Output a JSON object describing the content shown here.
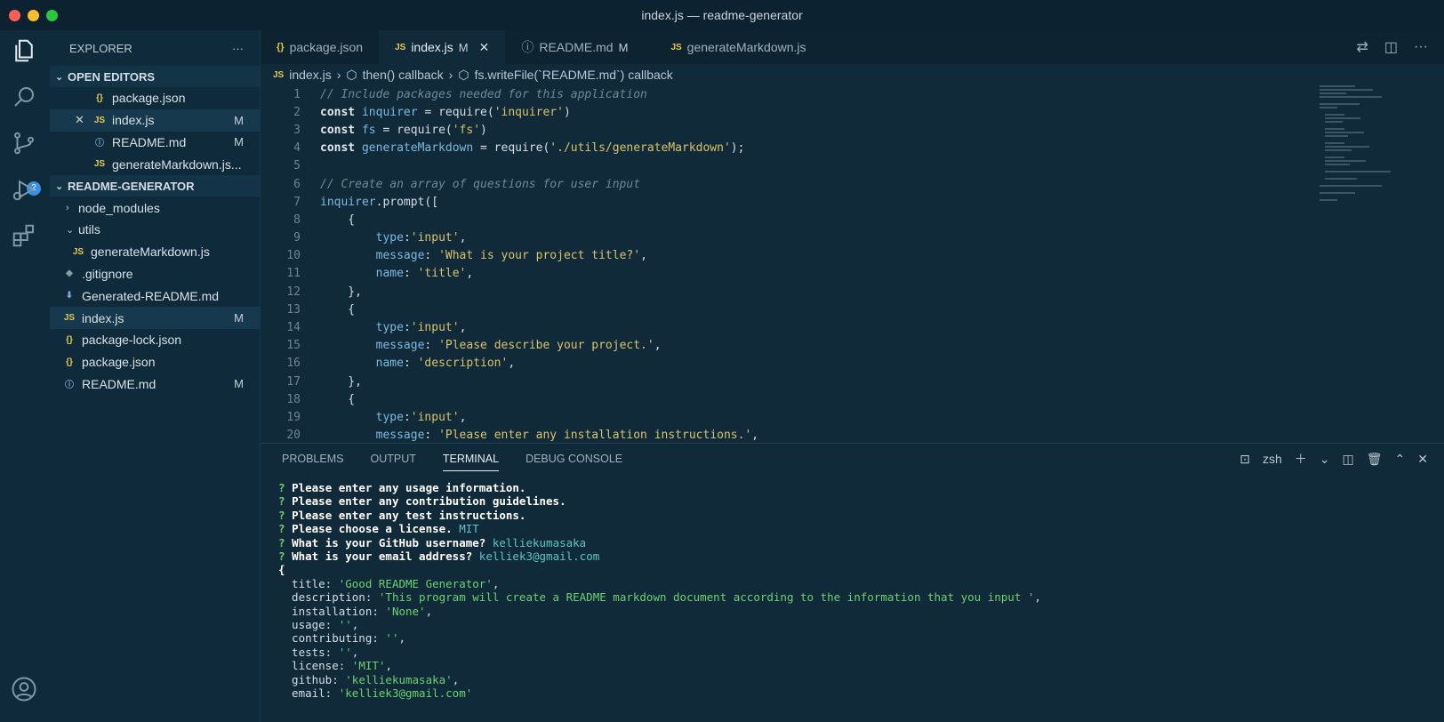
{
  "window": {
    "title": "index.js — readme-generator"
  },
  "colors": {
    "close": "#ff5f57",
    "minimize": "#febc2e",
    "maximize": "#28c840",
    "accent": "#3a8ee6"
  },
  "activity_bar": {
    "scm_badge": "2"
  },
  "sidebar": {
    "header": "EXPLORER",
    "open_editors_title": "OPEN EDITORS",
    "open_editors": [
      {
        "icon": "{}",
        "name": "package.json",
        "status": ""
      },
      {
        "icon": "JS",
        "name": "index.js",
        "status": "M"
      },
      {
        "icon": "ⓘ",
        "name": "README.md",
        "status": "M"
      },
      {
        "icon": "JS",
        "name": "generateMarkdown.js...",
        "status": ""
      }
    ],
    "project_title": "README-GENERATOR",
    "tree": [
      {
        "name": "node_modules",
        "status": ""
      },
      {
        "name": "utils",
        "status": ""
      },
      {
        "name": "generateMarkdown.js",
        "status": ""
      },
      {
        "name": ".gitignore",
        "status": ""
      },
      {
        "name": "Generated-README.md",
        "status": ""
      },
      {
        "name": "index.js",
        "status": "M"
      },
      {
        "name": "package-lock.json",
        "status": ""
      },
      {
        "name": "package.json",
        "status": ""
      },
      {
        "name": "README.md",
        "status": "M"
      }
    ]
  },
  "tabs": [
    {
      "icon": "{}",
      "label": "package.json",
      "status": ""
    },
    {
      "icon": "JS",
      "label": "index.js",
      "status": "M"
    },
    {
      "icon": "ⓘ",
      "label": "README.md",
      "status": "M"
    },
    {
      "icon": "JS",
      "label": "generateMarkdown.js",
      "status": ""
    }
  ],
  "breadcrumb": {
    "file": "index.js",
    "b1": "then() callback",
    "b2": "fs.writeFile(`README.md`) callback"
  },
  "code_lines": [
    "// Include packages needed for this application",
    "const inquirer = require('inquirer')",
    "const fs = require('fs')",
    "const generateMarkdown = require('./utils/generateMarkdown');",
    "",
    "// Create an array of questions for user input",
    "inquirer.prompt([",
    "    {",
    "        type:'input',",
    "        message: 'What is your project title?',",
    "        name: 'title',",
    "    },",
    "    {",
    "        type:'input',",
    "        message: 'Please describe your project.',",
    "        name: 'description',",
    "    },",
    "    {",
    "        type:'input',",
    "        message: 'Please enter any installation instructions.',"
  ],
  "panel": {
    "tabs": [
      "PROBLEMS",
      "OUTPUT",
      "TERMINAL",
      "DEBUG CONSOLE"
    ],
    "shell": "zsh"
  },
  "terminal": {
    "prompts": [
      {
        "q": "Please enter any usage information.",
        "a": ""
      },
      {
        "q": "Please enter any contribution guidelines.",
        "a": ""
      },
      {
        "q": "Please enter any test instructions.",
        "a": ""
      },
      {
        "q": "Please choose a license.",
        "a": "MIT"
      },
      {
        "q": "What is your GitHub username?",
        "a": "kelliekumasaka"
      },
      {
        "q": "What is your email address?",
        "a": "kelliek3@gmail.com"
      }
    ],
    "open_brace": "{",
    "object": [
      {
        "k": "title",
        "v": "'Good README Generator'"
      },
      {
        "k": "description",
        "v": "'This program will create a README markdown document according to the information that you input '"
      },
      {
        "k": "installation",
        "v": "'None'"
      },
      {
        "k": "usage",
        "v": "''"
      },
      {
        "k": "contributing",
        "v": "''"
      },
      {
        "k": "tests",
        "v": "''"
      },
      {
        "k": "license",
        "v": "'MIT'"
      },
      {
        "k": "github",
        "v": "'kelliekumasaka'"
      },
      {
        "k": "email",
        "v": "'kelliek3@gmail.com'"
      }
    ]
  }
}
